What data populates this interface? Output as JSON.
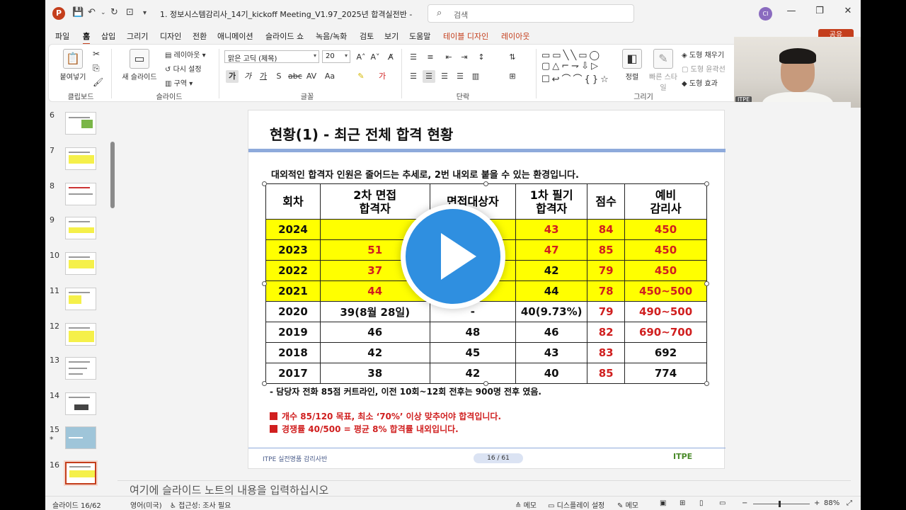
{
  "app": {
    "doc_title": "1. 정보시스템감리사_14기_kickoff Meeting_V1.97_2025년 합격실전반 - PowerP...",
    "search_placeholder": "검색",
    "user_initials": "CI",
    "share_label": "공유"
  },
  "menu": {
    "tabs": [
      "파일",
      "홈",
      "삽입",
      "그리기",
      "디자인",
      "전환",
      "애니메이션",
      "슬라이드 쇼",
      "녹음/녹화",
      "검토",
      "보기",
      "도움말",
      "테이블 디자인",
      "레이아웃"
    ],
    "active_index": 1
  },
  "ribbon": {
    "clipboard": {
      "paste": "붙여넣기",
      "label": "클립보드"
    },
    "slides": {
      "new_slide": "새 슬라이드",
      "layout": "레이아웃",
      "reset": "다시 설정",
      "section": "구역",
      "label": "슬라이드"
    },
    "font": {
      "family": "맑은 고딕 (제목)",
      "size": "20",
      "label": "글꼴"
    },
    "paragraph": {
      "label": "단락"
    },
    "drawing": {
      "arrange": "정렬",
      "quick_styles": "빠른 스타일",
      "fill": "도형 채우기",
      "outline": "도형 윤곽선",
      "effects": "도형 효과",
      "label": "그리기"
    }
  },
  "webcam": {
    "label": "ITPE"
  },
  "thumbnails": [
    {
      "num": "6",
      "star": ""
    },
    {
      "num": "7",
      "star": ""
    },
    {
      "num": "8",
      "star": ""
    },
    {
      "num": "9",
      "star": ""
    },
    {
      "num": "10",
      "star": ""
    },
    {
      "num": "11",
      "star": ""
    },
    {
      "num": "12",
      "star": ""
    },
    {
      "num": "13",
      "star": ""
    },
    {
      "num": "14",
      "star": ""
    },
    {
      "num": "15",
      "star": "*"
    },
    {
      "num": "16",
      "star": ""
    }
  ],
  "slide": {
    "title": "현황(1) - 최근 전체 합격 현황",
    "intro": "대외적인 합격자 인원은 줄어드는 추세로, 2번 내외로 붙을 수 있는 환경입니다.",
    "table": {
      "headers": [
        "회차",
        "2차 면접\n합격자",
        "면접대상자",
        "1차 필기\n합격자",
        "점수",
        "예비\n감리사"
      ],
      "rows": [
        {
          "highlight": true,
          "cells": [
            "2024",
            "",
            "",
            "43",
            "84",
            "450"
          ],
          "red": [
            false,
            true,
            true,
            true,
            true,
            true
          ]
        },
        {
          "highlight": true,
          "cells": [
            "2023",
            "51",
            "",
            "47",
            "85",
            "450"
          ],
          "red": [
            false,
            true,
            true,
            true,
            true,
            true
          ]
        },
        {
          "highlight": true,
          "cells": [
            "2022",
            "37",
            "",
            "42",
            "79",
            "450"
          ],
          "red": [
            false,
            true,
            true,
            false,
            true,
            true
          ]
        },
        {
          "highlight": true,
          "cells": [
            "2021",
            "44",
            "",
            "44",
            "78",
            "450~500"
          ],
          "red": [
            false,
            true,
            true,
            false,
            true,
            true
          ]
        },
        {
          "highlight": false,
          "cells": [
            "2020",
            "39(8월 28일)",
            "-",
            "40(9.73%)",
            "79",
            "490~500"
          ],
          "red": [
            false,
            false,
            false,
            false,
            true,
            true
          ]
        },
        {
          "highlight": false,
          "cells": [
            "2019",
            "46",
            "48",
            "46",
            "82",
            "690~700"
          ],
          "red": [
            false,
            false,
            false,
            false,
            true,
            true
          ]
        },
        {
          "highlight": false,
          "cells": [
            "2018",
            "42",
            "45",
            "43",
            "83",
            "692"
          ],
          "red": [
            false,
            false,
            false,
            false,
            true,
            false
          ]
        },
        {
          "highlight": false,
          "cells": [
            "2017",
            "38",
            "42",
            "40",
            "85",
            "774"
          ],
          "red": [
            false,
            false,
            false,
            false,
            true,
            false
          ]
        }
      ]
    },
    "note": "- 담당자 전화 85점 커트라인, 이전 10회~12회 전후는 900명 전후 였음.",
    "bullets": [
      "개수 85/120 목표, 최소 ‘70%’ 이상 맞추어야 합격입니다.",
      "경쟁률 40/500 = 평균 8% 합격률 내외입니다."
    ],
    "footer_left": "ITPE 실전명품 감리사반",
    "footer_page": "16 / 61",
    "footer_logo": "ITPE"
  },
  "notes_placeholder": "여기에 슬라이드 노트의 내용을 입력하십시오",
  "status": {
    "slide_pos": "슬라이드 16/62",
    "language": "영어(미국)",
    "accessibility": "접근성: 조사 필요",
    "notes_btn": "메모",
    "display_settings": "디스플레이 설정",
    "comments_btn": "메모",
    "zoom": "88%"
  },
  "colors": {
    "accent": "#c43e1c",
    "highlight": "#ffff00",
    "red_text": "#d01f1f",
    "play": "#2f8fe0"
  }
}
